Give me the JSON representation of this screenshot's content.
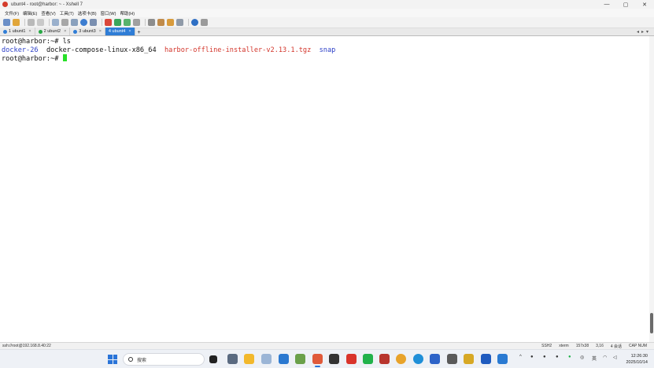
{
  "window": {
    "title": "ubunt4 - root@harbor: ~ - Xshell 7",
    "controls": [
      "—",
      "▢",
      "✕"
    ]
  },
  "menu": [
    "文件(F)",
    "编辑(E)",
    "查看(V)",
    "工具(T)",
    "选项卡(B)",
    "窗口(W)",
    "帮助(H)"
  ],
  "tabs": [
    {
      "label": "1 ubunt1",
      "dot": "#2f7dd6"
    },
    {
      "label": "2 ubunt2",
      "dot": "#27a844"
    },
    {
      "label": "3 ubunt3",
      "dot": "#2f7dd6"
    },
    {
      "label": "4 ubunt4",
      "dot": "",
      "active": true
    }
  ],
  "terminal": {
    "prompt": "root@harbor:~# ",
    "command": "ls",
    "entries": [
      {
        "name": "docker-26",
        "color": "blue"
      },
      {
        "name": "docker-compose-linux-x86_64",
        "color": "default"
      },
      {
        "name": "harbor-offline-installer-v2.13.1.tgz",
        "color": "red"
      },
      {
        "name": "snap",
        "color": "blue"
      }
    ]
  },
  "status": {
    "connection": "ssh://root@192.168.8.40:22",
    "protocol": "SSH2",
    "term": "xterm",
    "size": "157x38",
    "position": "3,16",
    "sessions": "4 会话",
    "caps": "CAP NUM"
  },
  "taskbar": {
    "search_placeholder": "搜索",
    "lang": "英",
    "time": "12:26:30",
    "date": "2025/10/14"
  },
  "colors": {
    "dir": "#2b3ec7",
    "archive": "#d3352b",
    "cursor": "#27e027",
    "active_tab": "#2f7dd6"
  }
}
